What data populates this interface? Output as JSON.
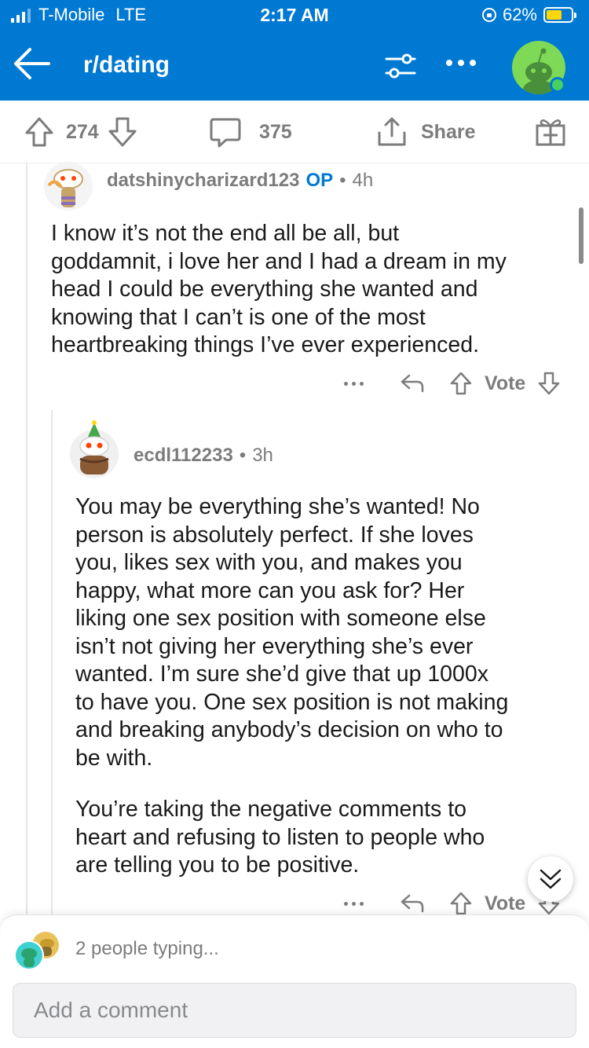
{
  "status_bar": {
    "carrier": "T-Mobile",
    "network": "LTE",
    "time": "2:17 AM",
    "battery_percent": "62%",
    "battery_level": 0.62
  },
  "nav": {
    "subreddit": "r/dating",
    "icons": [
      "back-arrow-icon",
      "filter-icon",
      "more-icon",
      "avatar"
    ]
  },
  "action_bar": {
    "upvotes": "274",
    "comments": "375",
    "share_label": "Share"
  },
  "comments": [
    {
      "username": "datshinycharizard123",
      "op_badge": "OP",
      "separator": "•",
      "age": "4h",
      "body_lines": [
        "I know it’s not the end all be all, but",
        "goddamnit, i love her and I had a dream in my",
        "head I could be everything she wanted and",
        "knowing that I can’t is one of the most",
        "heartbreaking things I’ve ever experienced."
      ],
      "vote_label": "Vote"
    },
    {
      "username": "ecdl112233",
      "separator": "•",
      "age": "3h",
      "paragraph1_lines": [
        "You may be everything she’s wanted! No",
        "person is absolutely perfect. If she loves",
        "you, likes sex with you, and makes you",
        "happy, what more can you ask for? Her",
        "liking one sex position with someone else",
        "isn’t not giving her everything she’s ever",
        "wanted. I’m sure she’d give that up 1000x",
        "to have you. One sex position is not making",
        "and breaking anybody’s decision on who to",
        "be with."
      ],
      "paragraph2_lines": [
        "You’re taking the negative comments to",
        "heart and refusing to listen to people who",
        "are telling you to be positive."
      ],
      "vote_label": "Vote"
    }
  ],
  "bottom": {
    "typing_text": "2 people typing...",
    "comment_placeholder": "Add a comment"
  },
  "colors": {
    "header": "#0079d3",
    "op": "#0079d3",
    "meta": "#7c7c7c",
    "avatar_green": "#7ed957",
    "online": "#46d160",
    "battery": "#ffd60a"
  }
}
